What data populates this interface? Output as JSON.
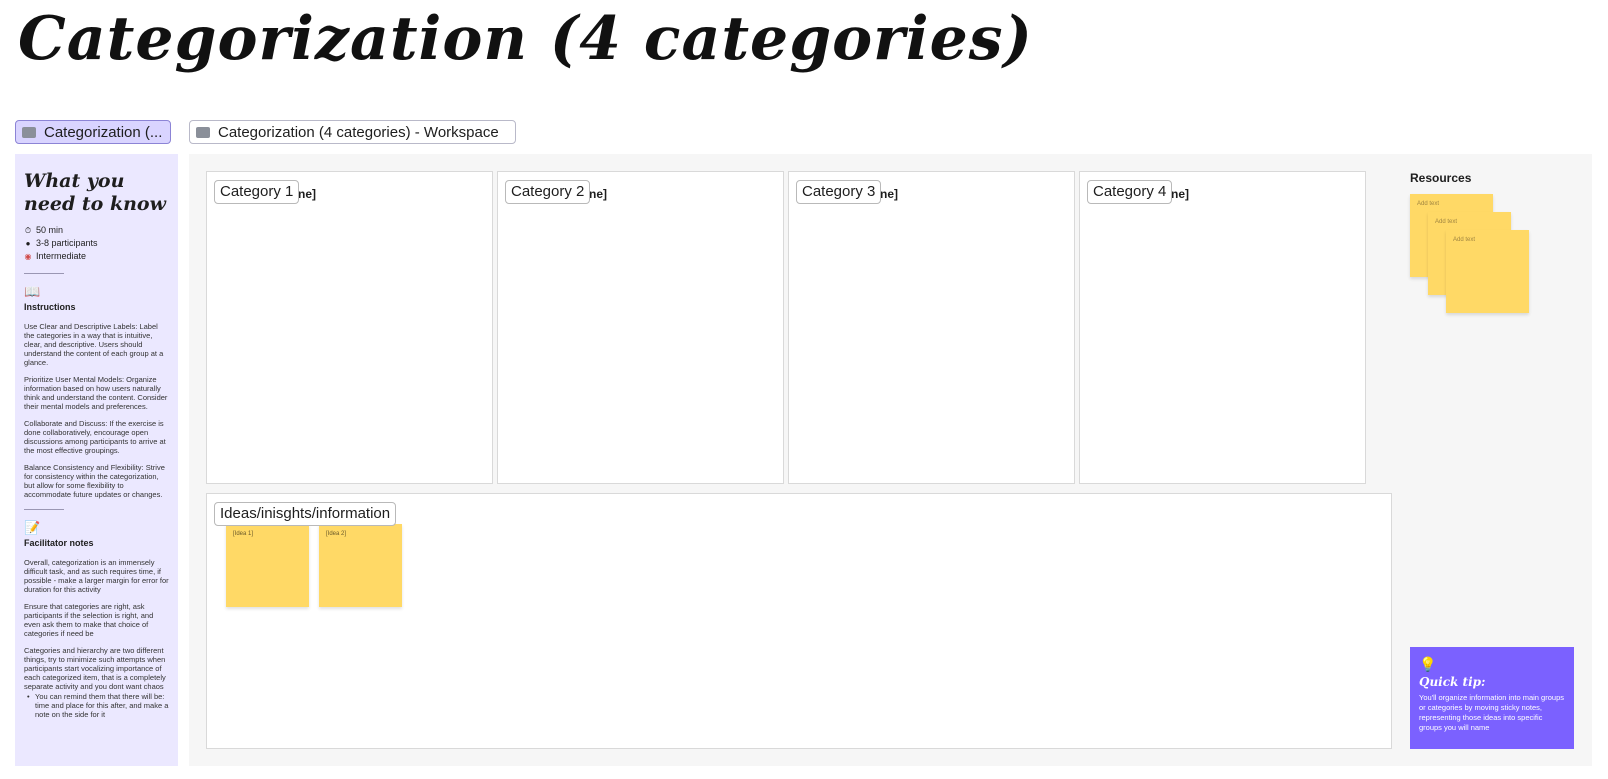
{
  "page": {
    "title": "Categorization (4 categories)"
  },
  "frames": {
    "left_tag": "Categorization (...",
    "workspace_tag": "Categorization (4 categories) - Workspace"
  },
  "left_panel": {
    "heading": "What you need to know",
    "meta": [
      {
        "icon": "timer-icon",
        "text": "50 min"
      },
      {
        "icon": "people-icon",
        "text": "3-8 participants"
      },
      {
        "icon": "target-icon",
        "text": "Intermediate"
      }
    ],
    "instructions": {
      "icon": "book-icon",
      "title": "Instructions",
      "paragraphs": [
        "Use Clear and Descriptive Labels: Label the categories in a way that is intuitive, clear, and descriptive. Users should understand the content of each group at a glance.",
        "Prioritize User Mental Models: Organize information based on how users naturally think and understand the content. Consider their mental models and preferences.",
        "Collaborate and Discuss: If the exercise is done collaboratively, encourage open discussions among participants to arrive at the most effective groupings.",
        "Balance Consistency and Flexibility: Strive for consistency within the categorization, but allow for some flexibility to accommodate future updates or changes."
      ]
    },
    "facilitator": {
      "icon": "memo-icon",
      "title": "Facilitator notes",
      "paragraphs": [
        "Overall, categorization is an immensely difficult task, and as such requires time, if possible - make a larger margin for error for duration for this activity",
        "Ensure that categories are right, ask participants if the selection  is right, and even ask them to make that choice of categories if need be",
        "Categories and hierarchy are two different things, try to minimize such attempts when participants start vocalizing importance of each categorized item, that is a completely separate activity and you dont want chaos"
      ],
      "bullet": "You can remind them that there will be: time and place for this after, and make a note on the side for it"
    }
  },
  "workspace": {
    "categories": [
      {
        "label": "Category 1",
        "ghost": "ne]"
      },
      {
        "label": "Category 2",
        "ghost": "ne]"
      },
      {
        "label": "Category 3",
        "ghost": "ne]"
      },
      {
        "label": "Category 4",
        "ghost": "ne]"
      }
    ],
    "ideas": {
      "label": "Ideas/inisghts/information",
      "stickies": [
        "[Idea 1]",
        "[Idea 2]"
      ]
    },
    "resources": {
      "title": "Resources",
      "stickies": [
        "Add text",
        "Add text",
        "Add text"
      ]
    },
    "tip": {
      "icon": "lightbulb-icon",
      "title": "Quick tip:",
      "text": "You'll organize information into main groups or categories by moving sticky notes, representing those ideas into specific groups you will name"
    }
  },
  "colors": {
    "sticky": "#ffd966",
    "panel": "#ebe8ff",
    "tip": "#7b61ff",
    "workspace_bg": "#f6f6f6"
  }
}
